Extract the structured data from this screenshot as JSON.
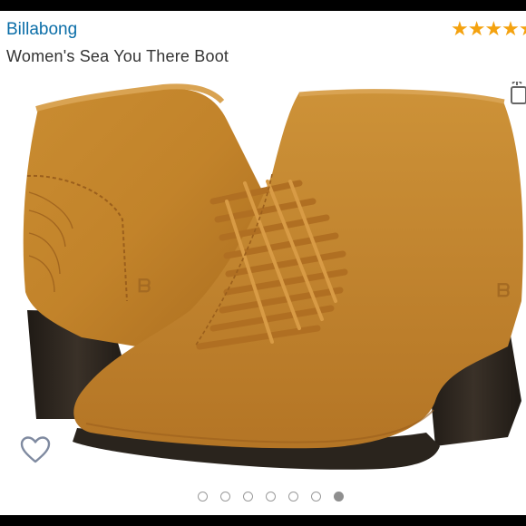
{
  "product": {
    "brand": "Billabong",
    "title": "Women's Sea You There Boot",
    "rating_stars": "★★★★★"
  },
  "icons": {
    "favorite": "heart-outline-icon",
    "share": "share-icon"
  },
  "carousel": {
    "slide_count": 7,
    "active_index": 6
  },
  "colors": {
    "brand_link": "#0b6ea8",
    "star": "#f4a20f",
    "leather": "#c88a2e",
    "sole": "#2a241d"
  }
}
